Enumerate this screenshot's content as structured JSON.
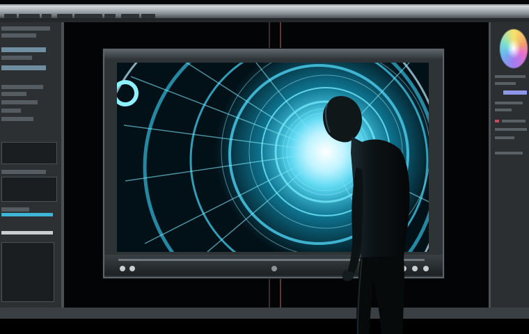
{
  "scene": {
    "subject": "person-silhouette",
    "display": "monitor-with-editing-software",
    "artwork": "glowing-cyan-mechanical-spiral"
  },
  "colors": {
    "glow_core": "#e8fbff",
    "glow_cyan": "#41d3ef",
    "glow_deep": "#0a6f8c",
    "ui_dark": "#2c3033",
    "ui_light": "#9aa2a8",
    "accent_red": "#c0505a"
  },
  "icons": [
    "play-icon",
    "stop-icon",
    "loop-icon",
    "color-wheel-icon"
  ]
}
